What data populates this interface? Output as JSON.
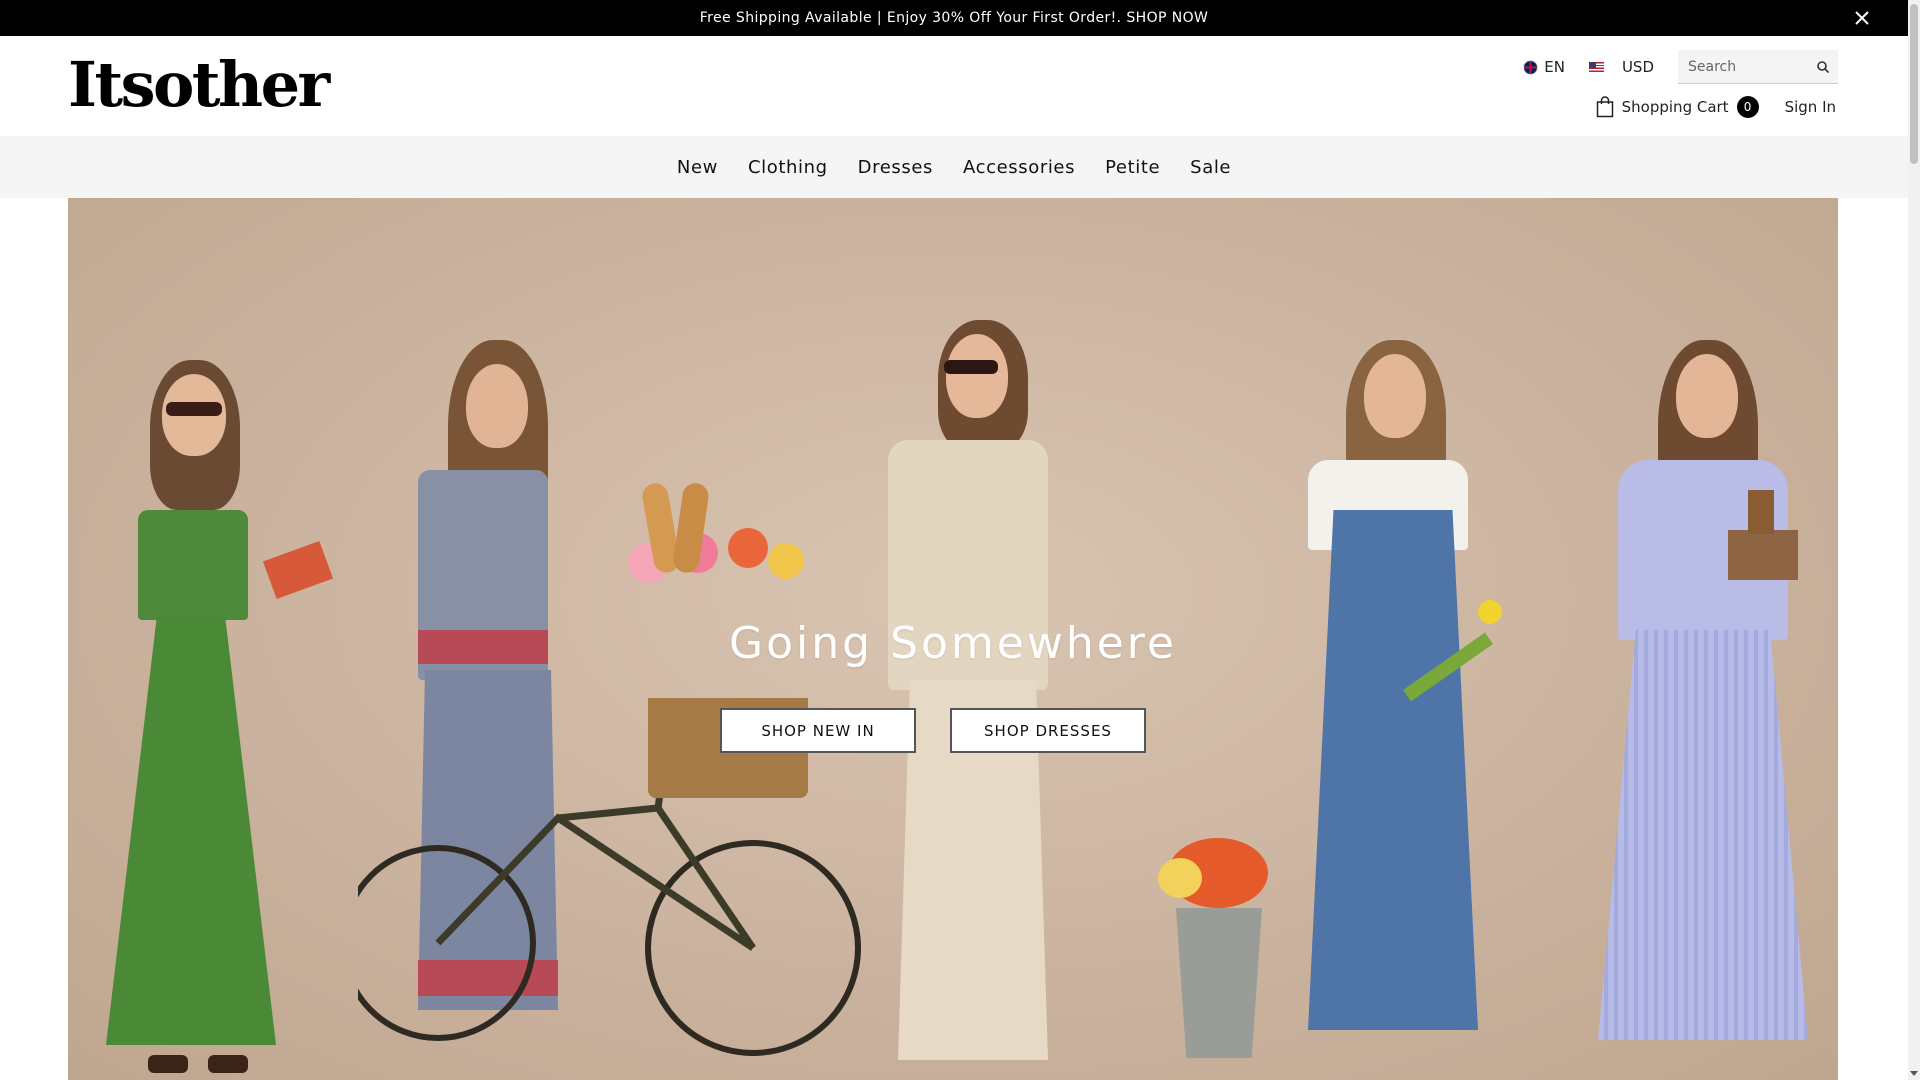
{
  "promo": {
    "text": "Free Shipping Available | Enjoy 30% Off Your First Order!. SHOP NOW",
    "close_icon": "close-icon"
  },
  "header": {
    "logo": "Itsother",
    "language": "EN",
    "currency": "USD",
    "search_placeholder": "Search",
    "cart_label": "Shopping Cart",
    "cart_count": "0",
    "sign_in": "Sign In"
  },
  "nav": {
    "items": [
      {
        "label": "New"
      },
      {
        "label": "Clothing"
      },
      {
        "label": "Dresses"
      },
      {
        "label": "Accessories"
      },
      {
        "label": "Petite"
      },
      {
        "label": "Sale"
      }
    ]
  },
  "hero": {
    "title": "Going Somewhere",
    "buttons": [
      {
        "label": "SHOP NEW IN"
      },
      {
        "label": "SHOP DRESSES"
      }
    ]
  },
  "colors": {
    "promo_bg": "#000000",
    "nav_bg": "#f5f5f5",
    "hero_bg": "#cdb6a2"
  }
}
